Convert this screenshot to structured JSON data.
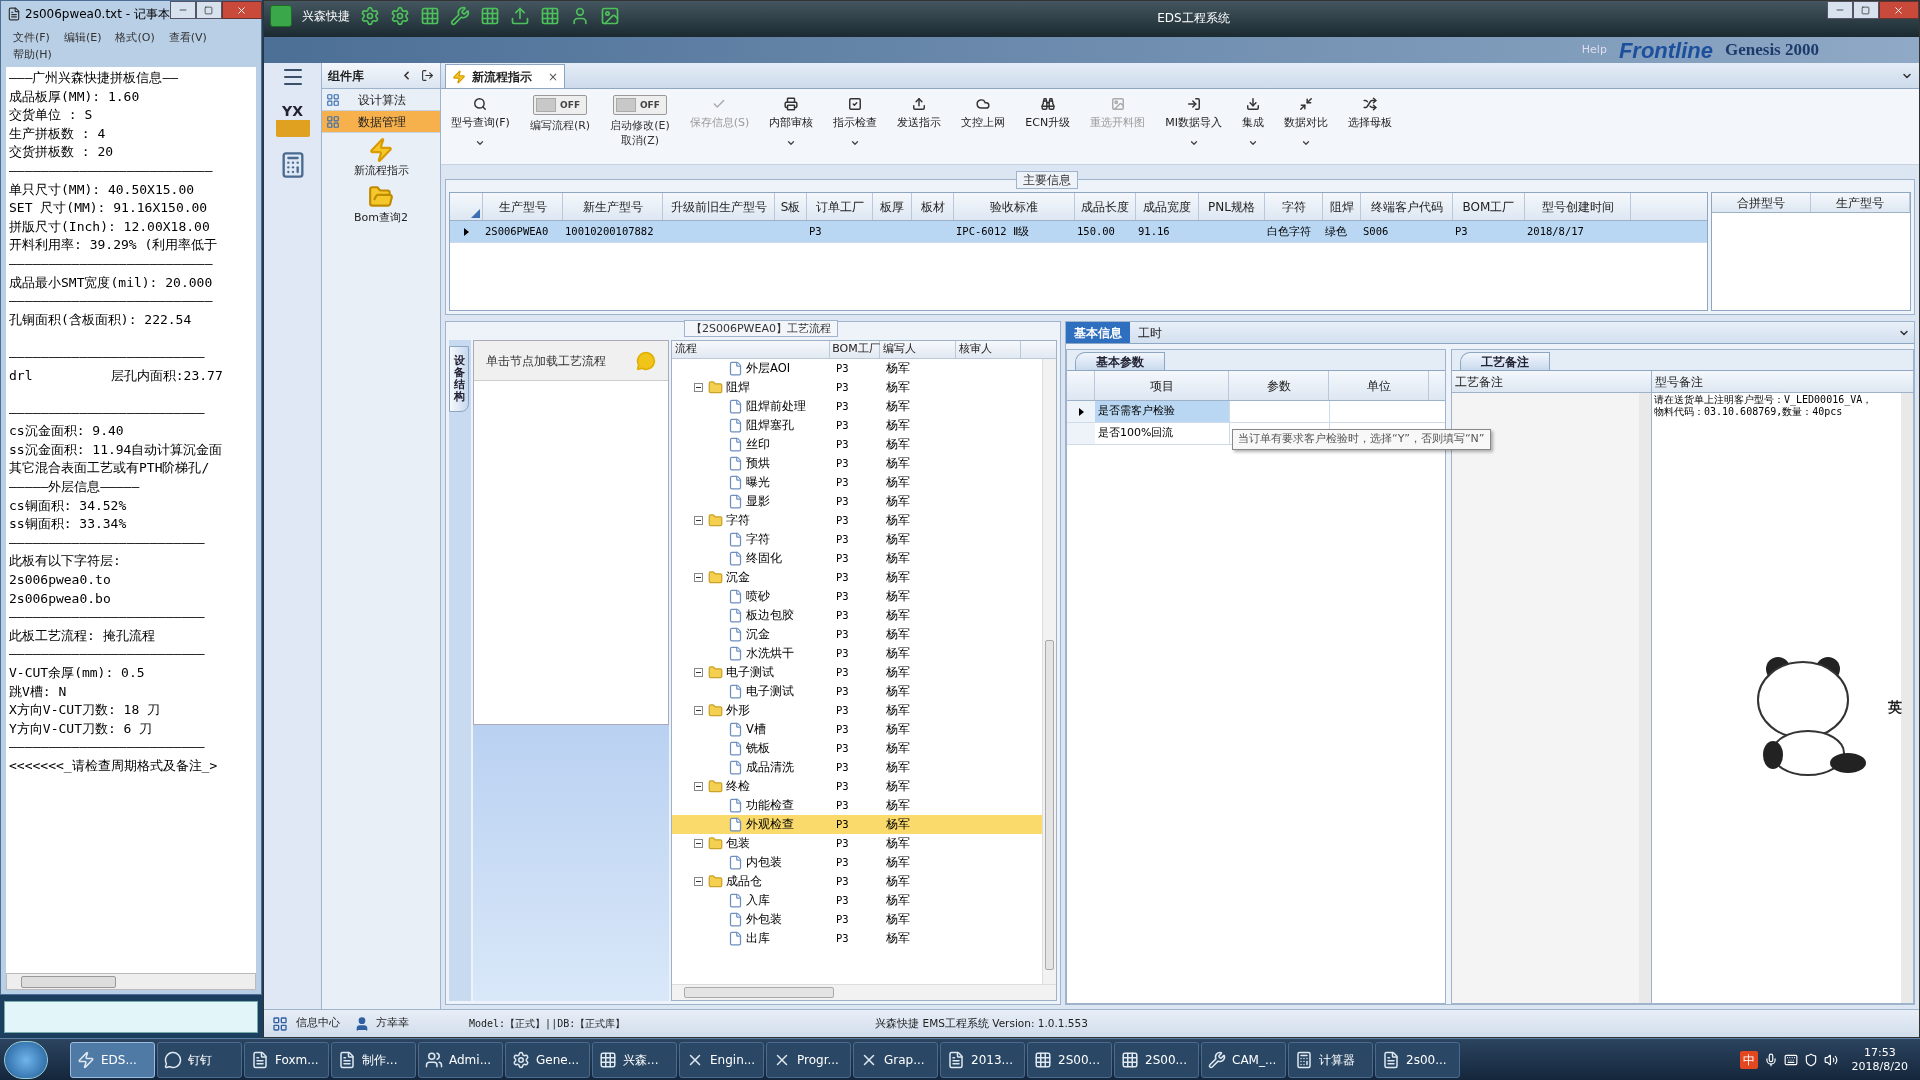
{
  "notepad": {
    "title": "2s006pwea0.txt - 记事本",
    "menu": [
      "文件(F)",
      "编辑(E)",
      "格式(O)",
      "查看(V)",
      "帮助(H)"
    ],
    "paragraphs": [
      [
        "———广州兴森快捷拼板信息——",
        "成品板厚(MM): 1.60",
        "交货单位 : S",
        "生产拼板数 : 4",
        "交货拼板数 : 20",
        "——————————————————————————",
        "单只尺寸(MM): 40.50X15.00",
        "SET 尺寸(MM): 91.16X150.00",
        "拼版尺寸(Inch): 12.00X18.00",
        "开料利用率: 39.29% (利用率低于",
        "——————————————————————————",
        "成品最小SMT宽度(mil): 20.000",
        "——————————————————————————",
        "孔铜面积(含板面积): 222.54"
      ],
      [
        "—————————————————————————",
        "drl          层孔内面积:23.77"
      ],
      [
        "—————————————————————————",
        "cs沉金面积: 9.40",
        "ss沉金面积: 11.94自动计算沉金面",
        "其它混合表面工艺或有PTH阶梯孔/",
        "—————外层信息—————",
        "cs铜面积: 34.52%",
        "ss铜面积: 33.34%",
        "—————————————————————————",
        "此板有以下字符层:",
        "2s006pwea0.to",
        "2s006pwea0.bo",
        "—————————————————————————",
        "此板工艺流程: 掩孔流程",
        "—————————————————————————",
        "V-CUT余厚(mm): 0.5",
        "跳V槽: N",
        "X方向V-CUT刀数: 18 刀",
        "Y方向V-CUT刀数: 6 刀",
        "—————————————————————————",
        "<<<<<<<_请检查周期格式及备注_>"
      ]
    ]
  },
  "app": {
    "brand": "兴森快捷",
    "title": "EDS工程系统",
    "backdrop": [
      "Help",
      "Frontline",
      "Genesis 2000"
    ]
  },
  "nav": {
    "logo_text": "YX"
  },
  "library": {
    "title": "组件库",
    "items": [
      {
        "label": "设计算法",
        "selected": false
      },
      {
        "label": "数据管理",
        "selected": true
      }
    ],
    "tools": [
      "新流程指示",
      "Bom查询2"
    ]
  },
  "tab": {
    "label": "新流程指示",
    "close": "×"
  },
  "toolbar": [
    {
      "kind": "button",
      "label": "型号查询(F)",
      "disabled": false,
      "menu": true
    },
    {
      "kind": "toggle",
      "label": "编写流程(R)",
      "state": "OFF",
      "on": false
    },
    {
      "kind": "toggle",
      "label": "启动修改(E)",
      "sublabel": "取消(Z)",
      "state": "OFF",
      "on": false
    },
    {
      "kind": "button",
      "label": "保存信息(S)",
      "disabled": true,
      "menu": false
    },
    {
      "kind": "button",
      "label": "内部审核",
      "disabled": false,
      "menu": true
    },
    {
      "kind": "button",
      "label": "指示检查",
      "disabled": false,
      "menu": true
    },
    {
      "kind": "button",
      "label": "发送指示",
      "disabled": false,
      "menu": false
    },
    {
      "kind": "button",
      "label": "文控上网",
      "disabled": false,
      "menu": false
    },
    {
      "kind": "button",
      "label": "ECN升级",
      "disabled": false,
      "menu": false
    },
    {
      "kind": "button",
      "label": "重选开料图",
      "disabled": true,
      "menu": false
    },
    {
      "kind": "button",
      "label": "MI数据导入",
      "disabled": false,
      "menu": true
    },
    {
      "kind": "button",
      "label": "集成",
      "disabled": false,
      "menu": true
    },
    {
      "kind": "button",
      "label": "数据对比",
      "disabled": false,
      "menu": true
    },
    {
      "kind": "button",
      "label": "选择母板",
      "disabled": false,
      "menu": false
    }
  ],
  "main_info": {
    "title": "主要信息",
    "columns": [
      "生产型号",
      "新生产型号",
      "升级前旧生产型号",
      "S板",
      "订单工厂",
      "板厚",
      "板材",
      "验收标准",
      "成品长度",
      "成品宽度",
      "PNL规格",
      "字符",
      "阻焊",
      "终端客户代码",
      "BOM工厂",
      "型号创建时间"
    ],
    "rows": [
      {
        "selected": true,
        "cells": [
          "2S006PWEA0",
          "10010200107882",
          null,
          null,
          "P3",
          null,
          null,
          "IPC-6012 Ⅱ级",
          "150.00",
          "91.16",
          null,
          "白色字符",
          "绿色",
          "S006",
          "P3",
          "2018/8/17"
        ]
      }
    ],
    "side_columns": [
      "合拼型号",
      "生产型号"
    ]
  },
  "process": {
    "title": "【2S006PWEA0】工艺流程",
    "side_tab": "设备结构",
    "hint": "单击节点加载工艺流程",
    "columns": [
      "流程",
      "BOM工厂",
      "编写人",
      "核审人"
    ],
    "nodes": [
      {
        "kind": "file",
        "label": "外层AOI",
        "bom": "P3",
        "writer": "杨军",
        "selected": false
      },
      {
        "kind": "folder",
        "label": "阻焊",
        "bom": "P3",
        "writer": "杨军",
        "expanded": true,
        "selected": false,
        "children": [
          {
            "kind": "file",
            "label": "阻焊前处理",
            "bom": "P3",
            "writer": "杨军",
            "selected": false
          },
          {
            "kind": "file",
            "label": "阻焊塞孔",
            "bom": "P3",
            "writer": "杨军",
            "selected": false
          },
          {
            "kind": "file",
            "label": "丝印",
            "bom": "P3",
            "writer": "杨军",
            "selected": false
          },
          {
            "kind": "file",
            "label": "预烘",
            "bom": "P3",
            "writer": "杨军",
            "selected": false
          },
          {
            "kind": "file",
            "label": "曝光",
            "bom": "P3",
            "writer": "杨军",
            "selected": false
          },
          {
            "kind": "file",
            "label": "显影",
            "bom": "P3",
            "writer": "杨军",
            "selected": false
          }
        ]
      },
      {
        "kind": "folder",
        "label": "字符",
        "bom": "P3",
        "writer": "杨军",
        "expanded": true,
        "selected": false,
        "children": [
          {
            "kind": "file",
            "label": "字符",
            "bom": "P3",
            "writer": "杨军",
            "selected": false
          },
          {
            "kind": "file",
            "label": "终固化",
            "bom": "P3",
            "writer": "杨军",
            "selected": false
          }
        ]
      },
      {
        "kind": "folder",
        "label": "沉金",
        "bom": "P3",
        "writer": "杨军",
        "expanded": true,
        "selected": false,
        "children": [
          {
            "kind": "file",
            "label": "喷砂",
            "bom": "P3",
            "writer": "杨军",
            "selected": false
          },
          {
            "kind": "file",
            "label": "板边包胶",
            "bom": "P3",
            "writer": "杨军",
            "selected": false
          },
          {
            "kind": "file",
            "label": "沉金",
            "bom": "P3",
            "writer": "杨军",
            "selected": false
          },
          {
            "kind": "file",
            "label": "水洗烘干",
            "bom": "P3",
            "writer": "杨军",
            "selected": false
          }
        ]
      },
      {
        "kind": "folder",
        "label": "电子测试",
        "bom": "P3",
        "writer": "杨军",
        "expanded": true,
        "selected": false,
        "children": [
          {
            "kind": "file",
            "label": "电子测试",
            "bom": "P3",
            "writer": "杨军",
            "selected": false
          }
        ]
      },
      {
        "kind": "folder",
        "label": "外形",
        "bom": "P3",
        "writer": "杨军",
        "expanded": true,
        "selected": false,
        "children": [
          {
            "kind": "file",
            "label": "V槽",
            "bom": "P3",
            "writer": "杨军",
            "selected": false
          },
          {
            "kind": "file",
            "label": "铣板",
            "bom": "P3",
            "writer": "杨军",
            "selected": false
          },
          {
            "kind": "file",
            "label": "成品清洗",
            "bom": "P3",
            "writer": "杨军",
            "selected": false
          }
        ]
      },
      {
        "kind": "folder",
        "label": "终检",
        "bom": "P3",
        "writer": "杨军",
        "expanded": true,
        "selected": false,
        "children": [
          {
            "kind": "file",
            "label": "功能检查",
            "bom": "P3",
            "writer": "杨军",
            "selected": false
          },
          {
            "kind": "file",
            "label": "外观检查",
            "bom": "P3",
            "writer": "杨军",
            "selected": true
          }
        ]
      },
      {
        "kind": "folder",
        "label": "包装",
        "bom": "P3",
        "writer": "杨军",
        "expanded": true,
        "selected": false,
        "children": [
          {
            "kind": "file",
            "label": "内包装",
            "bom": "P3",
            "writer": "杨军",
            "selected": false
          }
        ]
      },
      {
        "kind": "folder",
        "label": "成品仓",
        "bom": "P3",
        "writer": "杨军",
        "expanded": true,
        "selected": false,
        "children": [
          {
            "kind": "file",
            "label": "入库",
            "bom": "P3",
            "writer": "杨军",
            "selected": false
          },
          {
            "kind": "file",
            "label": "外包装",
            "bom": "P3",
            "writer": "杨军",
            "selected": false
          },
          {
            "kind": "file",
            "label": "出库",
            "bom": "P3",
            "writer": "杨军",
            "selected": false
          }
        ]
      }
    ]
  },
  "detail": {
    "tabs": [
      {
        "label": "基本信息",
        "selected": true
      },
      {
        "label": "工时",
        "selected": false
      }
    ],
    "params": {
      "tab": "基本参数",
      "columns": [
        "项目",
        "参数",
        "单位"
      ],
      "rows": [
        {
          "label": "是否需客户检验",
          "selected": true
        },
        {
          "label": "是否100%回流",
          "selected": false
        }
      ],
      "tooltip": "当订单有要求客户检验时，选择“Y”，否则填写“N”"
    },
    "notes": {
      "tab": "工艺备注",
      "columns": [
        "工艺备注",
        "型号备注"
      ],
      "lines": [
        "请在送货单上注明客户型号：V_LED00016_VA，",
        "物料代码：03.10.608769,数量：40pcs"
      ]
    }
  },
  "sticker": {
    "ime_label": "英"
  },
  "status": {
    "items": [
      "信息中心",
      "方幸幸"
    ],
    "model": "Model:【正式】||DB:【正式库】",
    "version": "兴森快捷 EMS工程系统 Version: 1.0.1.553"
  },
  "taskbar": {
    "items": [
      {
        "label": "EDS...",
        "selected": true
      },
      {
        "label": "钉钉",
        "selected": false
      },
      {
        "label": "Foxm...",
        "selected": false
      },
      {
        "label": "制作...",
        "selected": false
      },
      {
        "label": "Admi...",
        "selected": false
      },
      {
        "label": "Gene...",
        "selected": false
      },
      {
        "label": "兴森...",
        "selected": false
      },
      {
        "label": "Engin...",
        "selected": false
      },
      {
        "label": "Progr...",
        "selected": false
      },
      {
        "label": "Grap...",
        "selected": false
      },
      {
        "label": "2013...",
        "selected": false
      },
      {
        "label": "2S00...",
        "selected": false
      },
      {
        "label": "2S00...",
        "selected": false
      },
      {
        "label": "CAM_...",
        "selected": false
      },
      {
        "label": "计算器",
        "selected": false
      },
      {
        "label": "2s00...",
        "selected": false
      }
    ],
    "ime": "中",
    "time": "17:53",
    "date": "2018/8/20"
  }
}
